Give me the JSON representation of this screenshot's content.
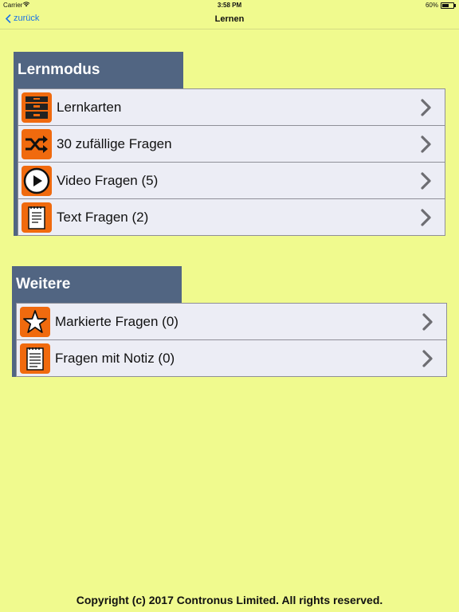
{
  "status_bar": {
    "carrier": "Carrier",
    "time": "3:58 PM",
    "battery_pct": "60%",
    "battery_level": 0.6
  },
  "nav": {
    "back_label": "zurück",
    "title": "Lernen"
  },
  "sections": [
    {
      "title": "Lernmodus",
      "items": [
        {
          "label": "Lernkarten",
          "icon": "card-box-icon"
        },
        {
          "label": "30 zufällige Fragen",
          "icon": "shuffle-icon"
        },
        {
          "label": "Video Fragen (5)",
          "icon": "play-icon"
        },
        {
          "label": "Text Fragen (2)",
          "icon": "notepad-icon"
        }
      ]
    },
    {
      "title": "Weitere",
      "items": [
        {
          "label": "Markierte Fragen (0)",
          "icon": "star-icon"
        },
        {
          "label": "Fragen mit Notiz (0)",
          "icon": "note-icon"
        }
      ]
    }
  ],
  "footer": {
    "copyright": "Copyright (c) 2017 Contronus Limited. All rights reserved."
  },
  "colors": {
    "background": "#f0fa8e",
    "header": "#516582",
    "icon_bg": "#f06a0e",
    "row_bg": "#ecedf5",
    "link": "#1a73e8"
  }
}
